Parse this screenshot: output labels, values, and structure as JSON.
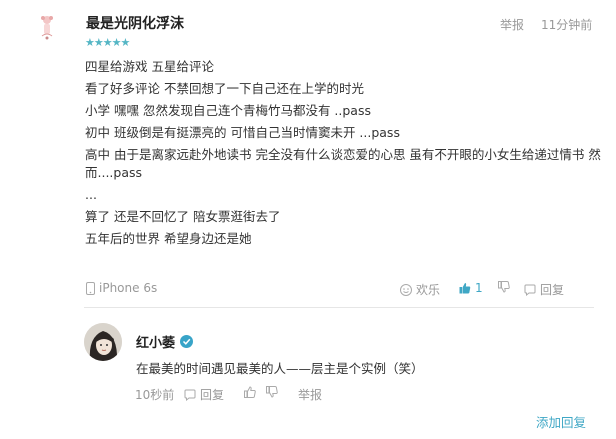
{
  "comment": {
    "username": "最是光阴化浮沫",
    "stars": "★★★★★",
    "report_label": "举报",
    "time": "11分钟前",
    "lines": [
      "四星给游戏 五星给评论",
      "看了好多评论 不禁回想了一下自己还在上学的时光",
      "小学 嘿嘿 忽然发现自己连个青梅竹马都没有 ..pass",
      "初中 班级倒是有挺漂亮的 可惜自己当时情窦未开 ...pass",
      "高中 由于是离家远赴外地读书 完全没有什么谈恋爱的心思 虽有不开眼的小女生给递过情书 然而....pass",
      "...",
      "算了 还是不回忆了 陪女票逛街去了",
      "五年后的世界 希望身边还是她"
    ],
    "device": "iPhone 6s",
    "happy_label": "欢乐",
    "like_count": "1",
    "reply_label": "回复"
  },
  "reply": {
    "username": "红小萎",
    "text": "在最美的时间遇见最美的人——层主是个实例（笑）",
    "time": "10秒前",
    "reply_label": "回复",
    "report_label": "举报"
  },
  "add_reply_label": "添加回复",
  "colors": {
    "accent": "#3fa7c5",
    "stars": "#55b6c5",
    "muted": "#999999"
  }
}
